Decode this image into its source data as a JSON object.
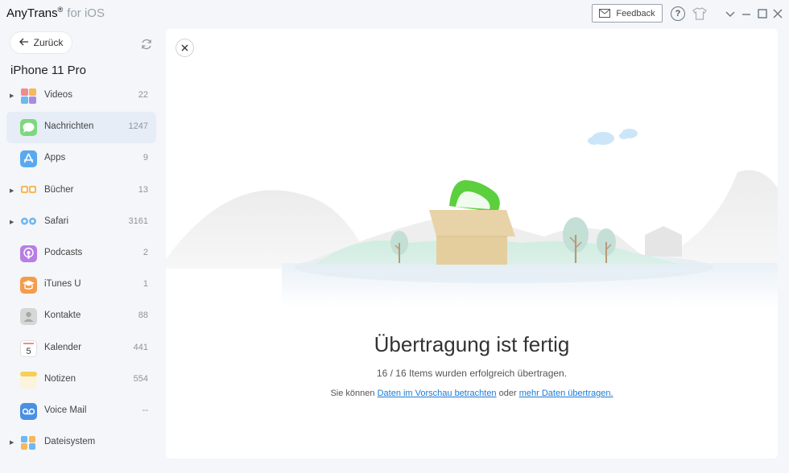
{
  "app": {
    "name": "AnyTrans",
    "reg": "®",
    "suffix": "for iOS"
  },
  "toolbar": {
    "feedback_label": "Feedback",
    "help_label": "?"
  },
  "sidebar": {
    "back_label": "Zurück",
    "device_name": "iPhone 11 Pro",
    "items": [
      {
        "label": "Videos",
        "count": "22",
        "icon": "videos-icon",
        "expandable": true
      },
      {
        "label": "Nachrichten",
        "count": "1247",
        "icon": "messages-icon",
        "expandable": false,
        "active": true
      },
      {
        "label": "Apps",
        "count": "9",
        "icon": "appstore-icon",
        "expandable": false
      },
      {
        "label": "Bücher",
        "count": "13",
        "icon": "books-icon",
        "expandable": true
      },
      {
        "label": "Safari",
        "count": "3161",
        "icon": "safari-icon",
        "expandable": true
      },
      {
        "label": "Podcasts",
        "count": "2",
        "icon": "podcasts-icon",
        "expandable": false
      },
      {
        "label": "iTunes U",
        "count": "1",
        "icon": "itunesu-icon",
        "expandable": false
      },
      {
        "label": "Kontakte",
        "count": "88",
        "icon": "contacts-icon",
        "expandable": false
      },
      {
        "label": "Kalender",
        "count": "441",
        "icon": "calendar-icon",
        "expandable": false,
        "calendar_day": "5"
      },
      {
        "label": "Notizen",
        "count": "554",
        "icon": "notes-icon",
        "expandable": false
      },
      {
        "label": "Voice Mail",
        "count": "--",
        "icon": "voicemail-icon",
        "expandable": false
      },
      {
        "label": "Dateisystem",
        "count": "",
        "icon": "filesystem-icon",
        "expandable": true
      }
    ]
  },
  "main": {
    "title": "Übertragung ist fertig",
    "subtitle": "16 / 16 Items wurden erfolgreich übertragen.",
    "links": {
      "prefix": "Sie können",
      "link1": "Daten im Vorschau betrachten",
      "middle": "oder",
      "link2": "mehr Daten übertragen."
    }
  },
  "colors": {
    "accent": "#1a7bd6",
    "active_row": "#e6edf7",
    "box": "#e8d3a8",
    "green": "#4cd964"
  }
}
